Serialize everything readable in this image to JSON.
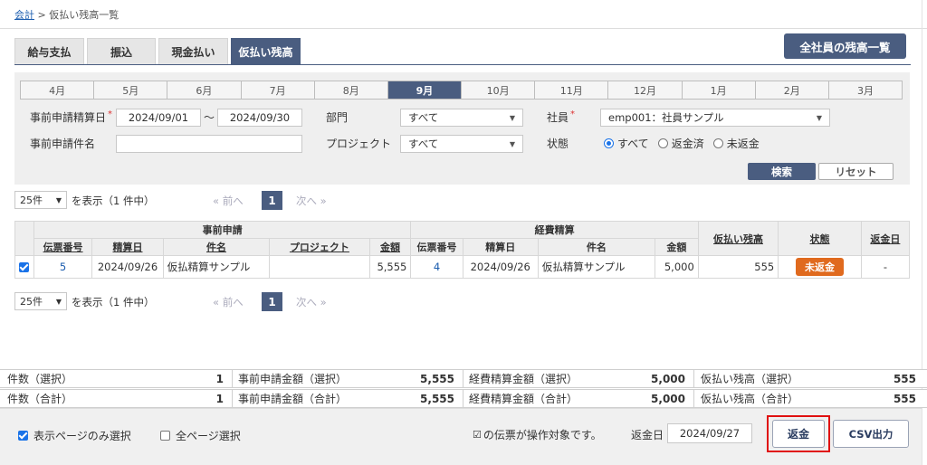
{
  "breadcrumb": {
    "root": "会計",
    "sep": " > ",
    "current": "仮払い残高一覧"
  },
  "tabs": [
    {
      "label": "給与支払",
      "active": false
    },
    {
      "label": "振込",
      "active": false
    },
    {
      "label": "現金払い",
      "active": false
    },
    {
      "label": "仮払い残高",
      "active": true
    }
  ],
  "all_balance_button": "全社員の残高一覧",
  "months": [
    "4月",
    "5月",
    "6月",
    "7月",
    "8月",
    "9月",
    "10月",
    "11月",
    "12月",
    "1月",
    "2月",
    "3月"
  ],
  "active_month": "9月",
  "filters": {
    "settle_date_label": "事前申請精算日",
    "required_mark": "*",
    "date_from": "2024/09/01",
    "range_sep": "〜",
    "date_to": "2024/09/30",
    "dept_label": "部門",
    "dept_value": "すべて",
    "employee_label": "社員",
    "employee_value": "emp001：社員サンプル",
    "subject_label": "事前申請件名",
    "subject_value": "",
    "project_label": "プロジェクト",
    "project_value": "すべて",
    "status_label": "状態",
    "status_options": [
      "すべて",
      "返金済",
      "未返金"
    ],
    "status_selected": "すべて"
  },
  "search_button": "検索",
  "reset_button": "リセット",
  "pager": {
    "per_page": "25件",
    "display_text": "を表示（1 件中）",
    "prev": "« 前へ",
    "current": "1",
    "next": "次へ »"
  },
  "table": {
    "group_pre": "事前申請",
    "group_exp": "経費精算",
    "headers": {
      "pre_no": "伝票番号",
      "pre_date": "精算日",
      "pre_subject": "件名",
      "pre_project": "プロジェクト",
      "pre_amount": "金額",
      "exp_no": "伝票番号",
      "exp_date": "精算日",
      "exp_subject": "件名",
      "exp_amount": "金額",
      "balance": "仮払い残高",
      "status": "状態",
      "return_date": "返金日"
    },
    "rows": [
      {
        "checked": true,
        "pre_no": "5",
        "pre_date": "2024/09/26",
        "pre_subject": "仮払精算サンプル",
        "pre_project": "",
        "pre_amount": "5,555",
        "exp_no": "4",
        "exp_date": "2024/09/26",
        "exp_subject": "仮払精算サンプル",
        "exp_amount": "5,000",
        "balance": "555",
        "status": "未返金",
        "return_date": "-"
      }
    ]
  },
  "summary": {
    "selected": {
      "count_label": "件数（選択）",
      "count": "1",
      "pre_label": "事前申請金額（選択）",
      "pre_amount": "5,555",
      "exp_label": "経費精算金額（選択）",
      "exp_amount": "5,000",
      "bal_label": "仮払い残高（選択）",
      "bal_amount": "555"
    },
    "total": {
      "count_label": "件数（合計）",
      "count": "1",
      "pre_label": "事前申請金額（合計）",
      "pre_amount": "5,555",
      "exp_label": "経費精算金額（合計）",
      "exp_amount": "5,000",
      "bal_label": "仮払い残高（合計）",
      "bal_amount": "555"
    }
  },
  "footer": {
    "page_only_label": "表示ページのみ選択",
    "page_only_checked": true,
    "all_pages_label": "全ページ選択",
    "all_pages_checked": false,
    "target_note": "の伝票が操作対象です。",
    "return_date_label": "返金日",
    "return_date_value": "2024/09/27",
    "return_button": "返金",
    "csv_button": "CSV出力"
  },
  "colors": {
    "accent": "#4a5d80",
    "status_unreturned": "#e06a1e",
    "highlight_border": "#e01010"
  }
}
